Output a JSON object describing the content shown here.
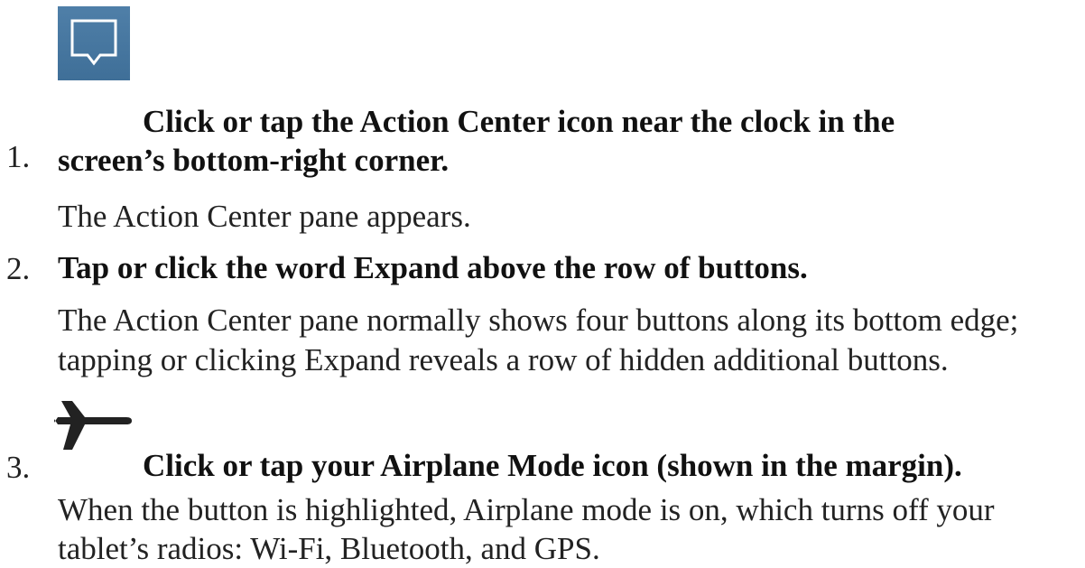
{
  "steps": [
    {
      "number": "1.",
      "icon": "action-center-icon",
      "heading_line1": "Click or tap the Action Center icon near the clock in the",
      "heading_line2": "screen’s bottom-right corner.",
      "body": "The Action Center pane appears."
    },
    {
      "number": "2.",
      "heading": "Tap or click the word Expand above the row of buttons.",
      "body": "The Action Center pane normally shows four buttons along its bottom edge; tapping or clicking Expand reveals a row of hidden additional buttons."
    },
    {
      "number": "3.",
      "icon": "airplane-icon",
      "heading": "Click or tap your Airplane Mode icon (shown in the margin).",
      "body": "When the button is highlighted, Airplane mode is on, which turns off your tablet’s radios: Wi-Fi, Bluetooth, and GPS."
    }
  ],
  "colors": {
    "text": "#222222",
    "heading": "#111111",
    "action_center_icon_bg": "#4a7aa3",
    "action_center_icon_fg": "#ffffff",
    "airplane_icon": "#222222"
  }
}
